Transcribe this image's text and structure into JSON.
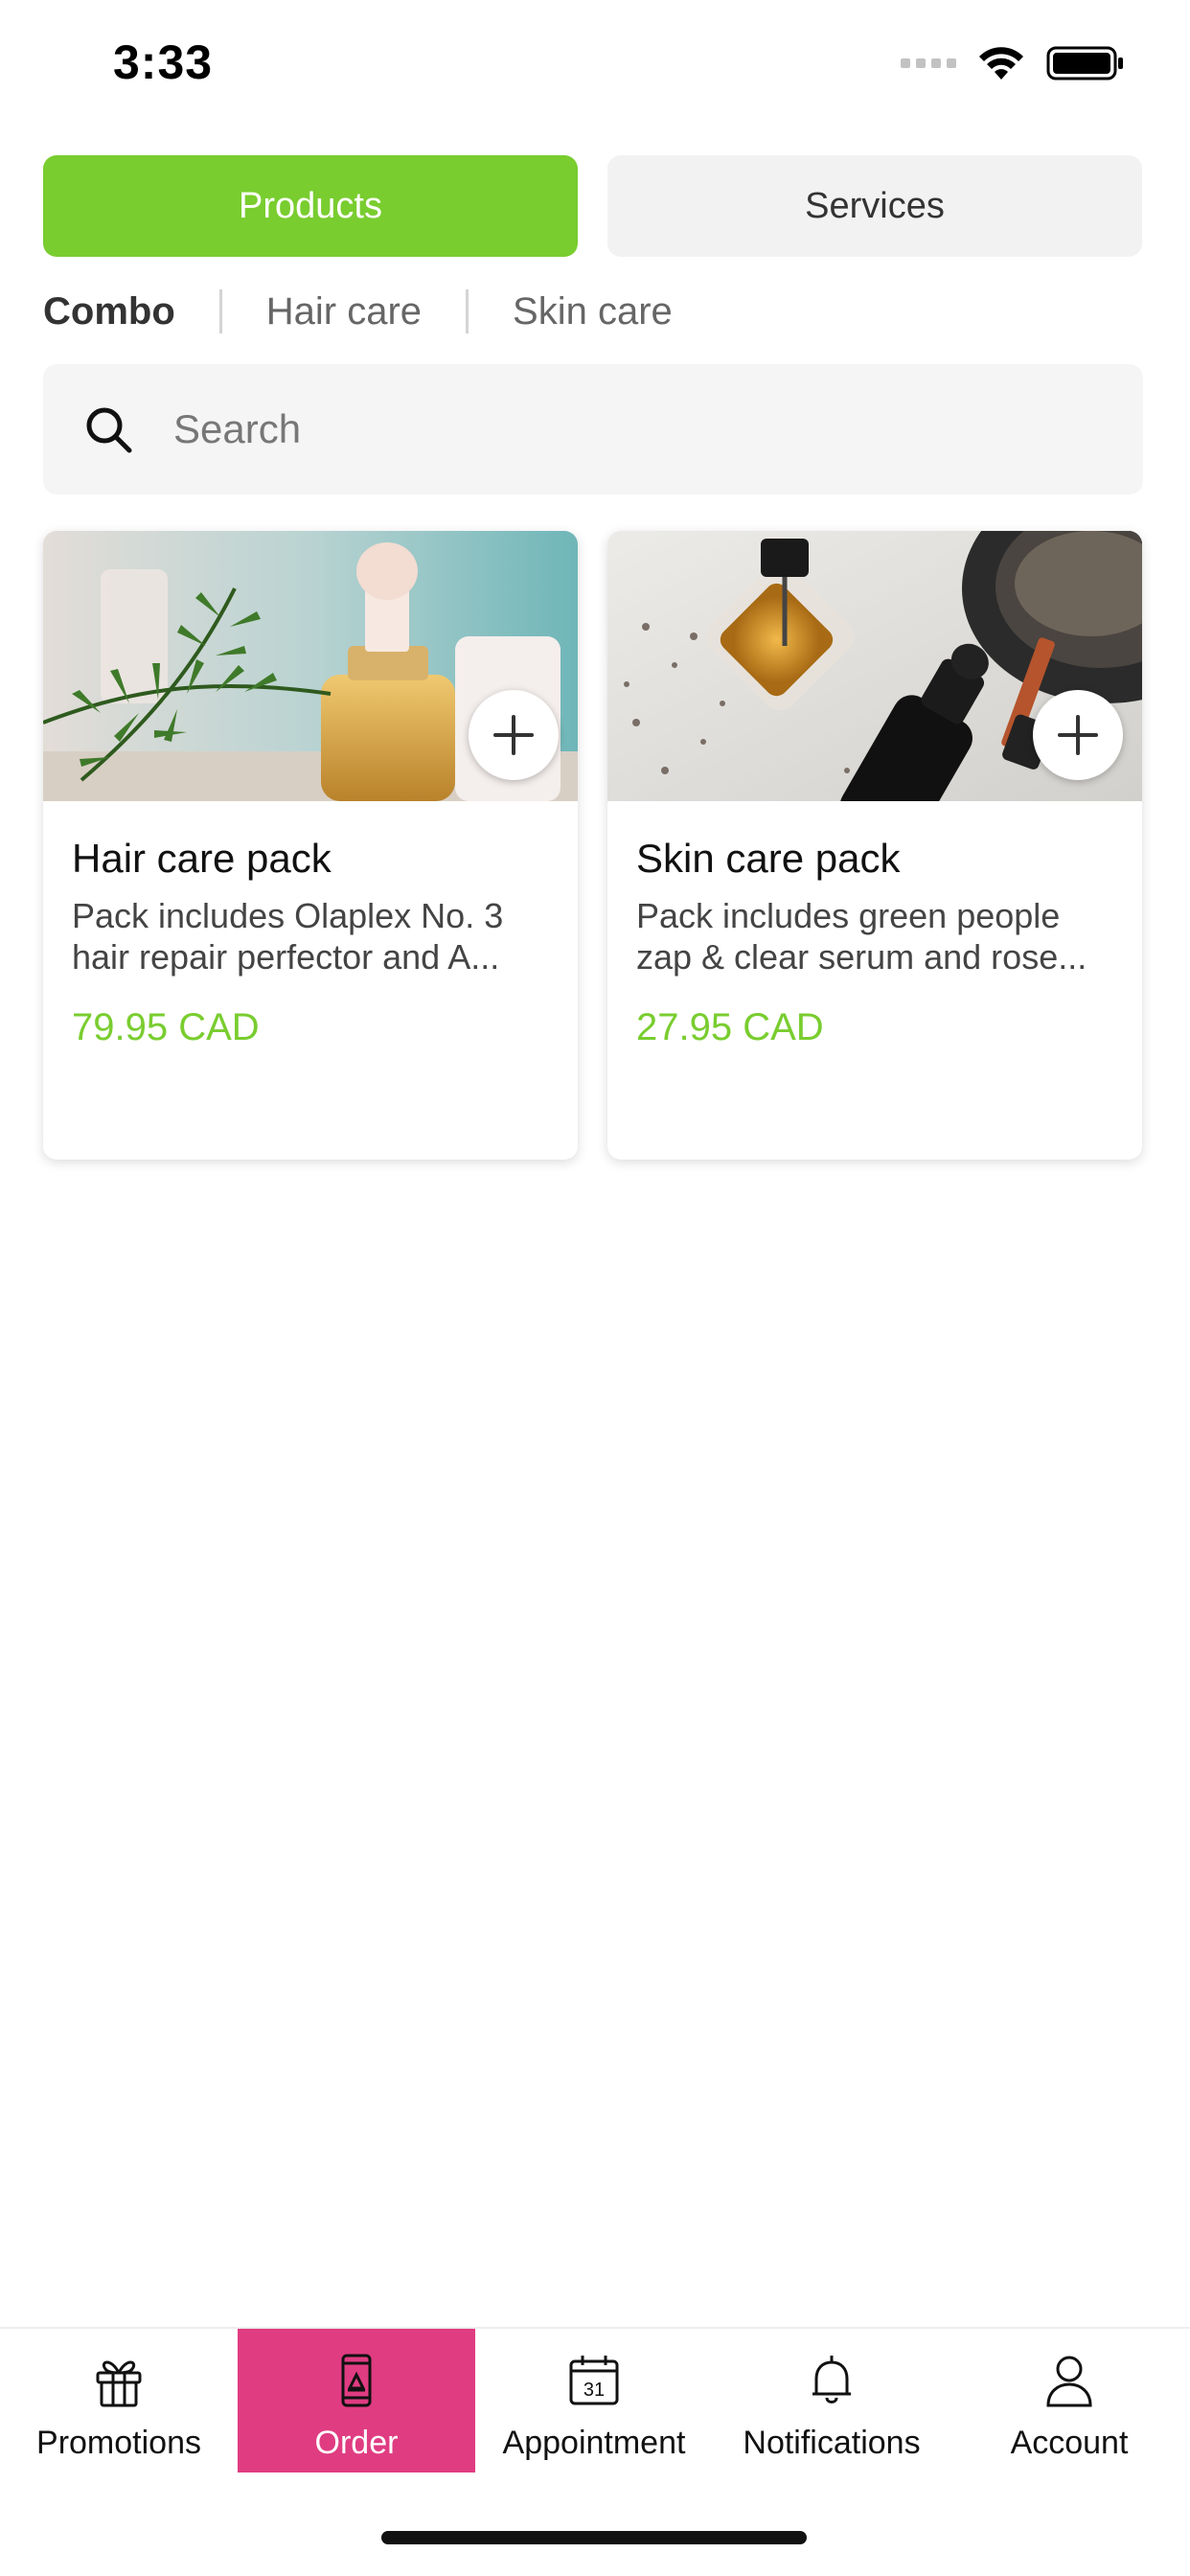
{
  "status_bar": {
    "time": "3:33"
  },
  "segments": {
    "products": "Products",
    "services": "Services",
    "active": "products"
  },
  "category_tabs": [
    {
      "label": "Combo",
      "active": true
    },
    {
      "label": "Hair care",
      "active": false
    },
    {
      "label": "Skin care",
      "active": false
    }
  ],
  "search": {
    "placeholder": "Search"
  },
  "products": [
    {
      "title": "Hair care pack",
      "description": "Pack includes Olaplex No. 3 hair repair perfector and A...",
      "price": "79.95 CAD",
      "image_icon": "oil-bottle-rosemary-photo"
    },
    {
      "title": "Skin care pack",
      "description": "Pack includes green people zap & clear serum and rose...",
      "price": "27.95 CAD",
      "image_icon": "serum-bottles-photo"
    }
  ],
  "bottom_nav": [
    {
      "label": "Promotions",
      "icon": "gift-icon",
      "active": false
    },
    {
      "label": "Order",
      "icon": "phone-order-icon",
      "active": true
    },
    {
      "label": "Appointment",
      "icon": "calendar-icon",
      "active": false
    },
    {
      "label": "Notifications",
      "icon": "bell-icon",
      "active": false
    },
    {
      "label": "Account",
      "icon": "user-icon",
      "active": false
    }
  ],
  "calendar_day": "31",
  "colors": {
    "accent_green": "#79cd2f",
    "nav_active": "#e03c82",
    "segment_inactive": "#f2f2f2"
  }
}
